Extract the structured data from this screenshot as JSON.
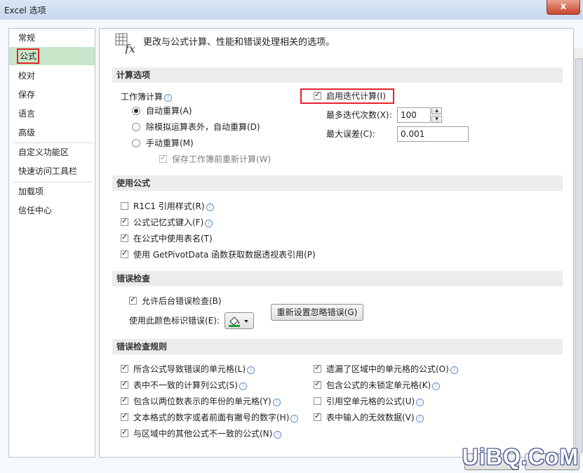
{
  "window": {
    "title": "Excel 选项",
    "close_label": "x"
  },
  "sidebar": {
    "items": [
      {
        "label": "常规",
        "active": false
      },
      {
        "label": "公式",
        "active": true
      },
      {
        "label": "校对",
        "active": false
      },
      {
        "label": "保存",
        "active": false
      },
      {
        "label": "语言",
        "active": false
      },
      {
        "label": "高级",
        "active": false
      },
      {
        "label": "自定义功能区",
        "active": false
      },
      {
        "label": "快速访问工具栏",
        "active": false
      },
      {
        "label": "加载项",
        "active": false
      },
      {
        "label": "信任中心",
        "active": false
      }
    ]
  },
  "header": {
    "text": "更改与公式计算、性能和错误处理相关的选项。",
    "icon": "formula-fx-icon"
  },
  "calc": {
    "section_title": "计算选项",
    "workbook_label": "工作簿计算",
    "auto": "自动重算(A)",
    "auto_except": "除模拟运算表外，自动重算(D)",
    "manual": "手动重算(M)",
    "recalc_before_save": "保存工作簿前重新计算(W)",
    "iterative": "启用迭代计算(I)",
    "max_iter_label": "最多迭代次数(X):",
    "max_iter_value": "100",
    "max_change_label": "最大误差(C):",
    "max_change_value": "0.001"
  },
  "formulas": {
    "section_title": "使用公式",
    "r1c1": "R1C1 引用样式(R)",
    "autocomplete": "公式记忆式键入(F)",
    "table_names": "在公式中使用表名(T)",
    "getpivot": "使用 GetPivotData 函数获取数据透视表引用(P)"
  },
  "errorcheck": {
    "section_title": "错误检查",
    "enable_bg": "允许后台错误检查(B)",
    "color_label": "使用此颜色标识错误(E):",
    "reset_btn": "重新设置忽略错误(G)",
    "color": "#1f9a3a"
  },
  "rules": {
    "section_title": "错误检查规则",
    "left": [
      {
        "label": "所含公式导致错误的单元格(L)",
        "checked": true
      },
      {
        "label": "表中不一致的计算列公式(S)",
        "checked": true
      },
      {
        "label": "包含以两位数表示的年份的单元格(Y)",
        "checked": true
      },
      {
        "label": "文本格式的数字或者前面有撇号的数字(H)",
        "checked": true
      },
      {
        "label": "与区域中的其他公式不一致的公式(N)",
        "checked": true
      }
    ],
    "right": [
      {
        "label": "遗漏了区域中的单元格的公式(O)",
        "checked": true
      },
      {
        "label": "包含公式的未锁定单元格(K)",
        "checked": true
      },
      {
        "label": "引用空单元格的公式(U)",
        "checked": false
      },
      {
        "label": "表中输入的无效数据(V)",
        "checked": true
      }
    ]
  },
  "watermark": "UiBQ.CoM"
}
